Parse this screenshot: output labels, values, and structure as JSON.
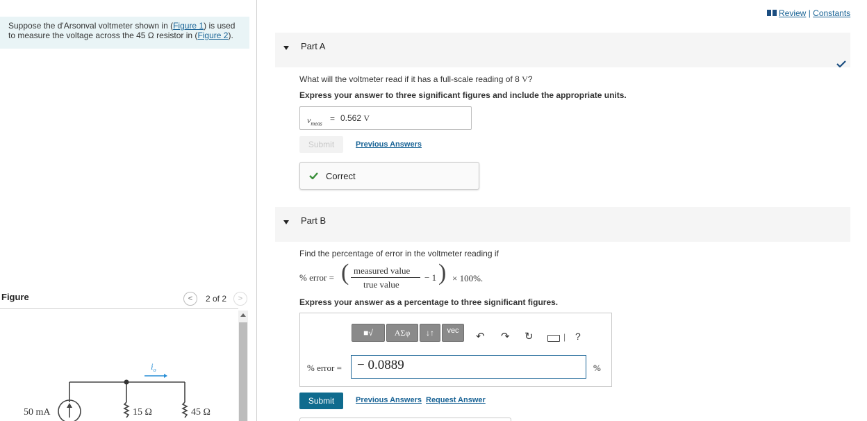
{
  "problem": {
    "text_before_fig1": "Suppose the d'Arsonval voltmeter shown in (",
    "fig1_link": "Figure 1",
    "text_between": ") is used to measure the voltage across the 45 Ω resistor in (",
    "fig2_link": "Figure 2",
    "text_after": ")."
  },
  "figure": {
    "label": "Figure",
    "counter": "2 of 2",
    "prev_icon": "chevron-left-icon",
    "next_icon": "chevron-right-icon",
    "circuit": {
      "source_label": "50 mA",
      "current_label": "i",
      "current_sub": "o",
      "r1_label": "15 Ω",
      "r2_label": "45 Ω"
    }
  },
  "header": {
    "review_label": "Review",
    "separator": " | ",
    "constants_label": "Constants",
    "book_icon": "book-icon"
  },
  "partA": {
    "title": "Part A",
    "question_pre": "What will the voltmeter read if it has a full-scale reading of 8 ",
    "question_unit": "V",
    "question_post": "?",
    "instructions": "Express your answer to three significant figures and include the appropriate units.",
    "var_name": "v",
    "var_sub": "meas",
    "equals": "=",
    "answer_value": "0.562",
    "answer_unit": "V",
    "submit_label": "Submit",
    "previous_answers_label": "Previous Answers",
    "feedback": "Correct",
    "status_icon": "checkmark-icon"
  },
  "partB": {
    "title": "Part B",
    "question": "Find the percentage of error in the voltmeter reading if",
    "formula": {
      "lhs": "% error =",
      "numerator": "measured value",
      "denominator": "true value",
      "minus_one": "− 1",
      "times": "× 100%."
    },
    "instructions": "Express your answer as a percentage to three significant figures.",
    "toolbar": {
      "templates_label": "■√",
      "greek_label": "ΑΣφ",
      "arrows_label": "↓↑",
      "vec_label": "vec",
      "undo_icon": "undo-icon",
      "redo_icon": "redo-icon",
      "reset_icon": "reset-icon",
      "keyboard_icon": "keyboard-icon",
      "help_label": "?"
    },
    "input_label": "% error =",
    "answer_value": "− 0.0889",
    "unit": "%",
    "submit_label": "Submit",
    "previous_answers_label": "Previous Answers",
    "request_answer_label": "Request Answer"
  },
  "colors": {
    "link": "#1a6496",
    "accent": "#0f6b8e",
    "correct_green": "#3a8f3a",
    "problem_bg": "#e9f4f6"
  }
}
